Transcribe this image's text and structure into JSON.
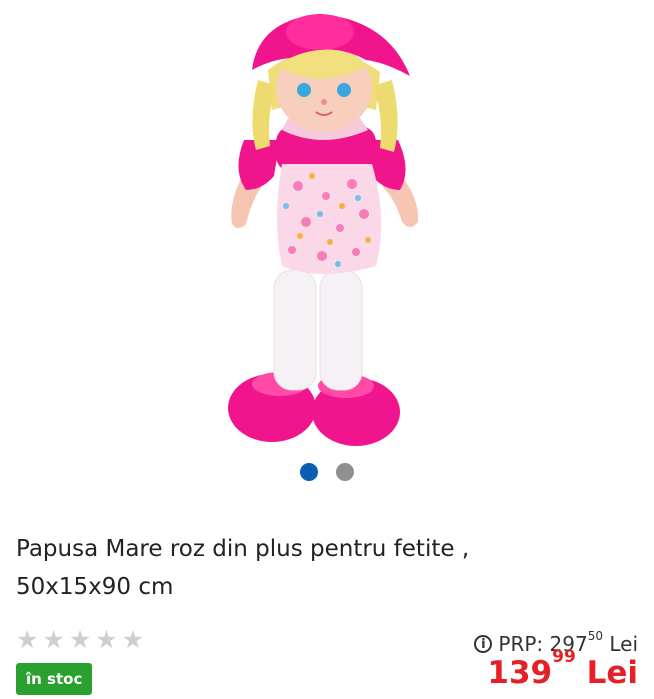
{
  "gallery": {
    "dots": [
      {
        "name": "slide-1",
        "active": true
      },
      {
        "name": "slide-2",
        "active": false
      }
    ]
  },
  "product": {
    "title_line1": "Papusa Mare roz din plus pentru fetite ,",
    "title_line2": "50x15x90 cm",
    "rating_stars": 5,
    "stock_label": "în stoc",
    "prp_label": "PRP: 297",
    "prp_decimals": "50",
    "prp_currency": "Lei",
    "price_int": "139",
    "price_decimals": "99",
    "price_currency": "Lei"
  },
  "colors": {
    "accent_price": "#e52027",
    "stock_green": "#2aa02f",
    "active_dot": "#0b5fb0"
  },
  "icons": [
    "info-icon",
    "star-icon"
  ]
}
